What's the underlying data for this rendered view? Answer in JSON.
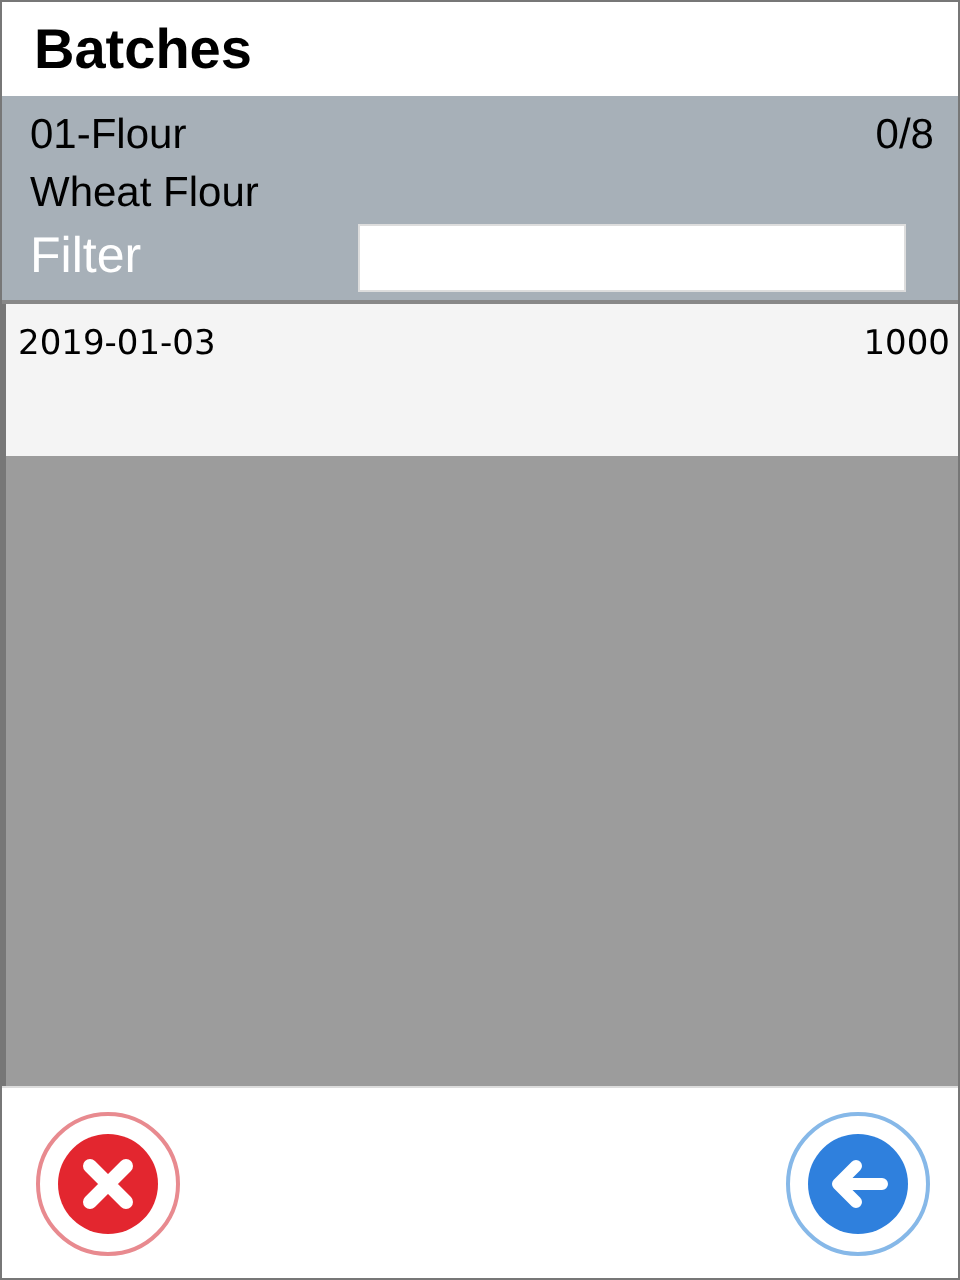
{
  "title": "Batches",
  "header": {
    "code": "01-Flour",
    "count": "0/8",
    "name": "Wheat Flour",
    "filter": {
      "label": "Filter"
    }
  },
  "rows": [
    {
      "date": "2019-01-03",
      "quantity": "1000"
    }
  ],
  "buttons": [
    {
      "kind": "cancel"
    },
    {
      "kind": "back"
    }
  ]
}
